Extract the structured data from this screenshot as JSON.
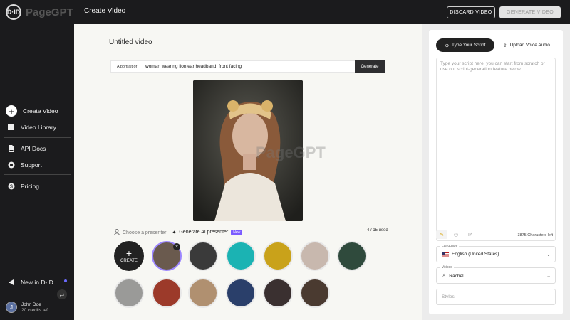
{
  "brand": {
    "logo_mark": "D·ID",
    "watermark": "PageGPT"
  },
  "header": {
    "title": "Create Video",
    "discard_label": "DISCARD VIDEO",
    "generate_label": "GENERATE VIDEO"
  },
  "sidebar": {
    "items": [
      {
        "label": "Create Video",
        "icon": "plus-circle-icon"
      },
      {
        "label": "Video Library",
        "icon": "grid-icon"
      },
      {
        "label": "API Docs",
        "icon": "document-icon"
      },
      {
        "label": "Support",
        "icon": "lifebuoy-icon"
      },
      {
        "label": "Pricing",
        "icon": "dollar-icon"
      }
    ],
    "new_in": "New in D-ID",
    "user": {
      "initial": "J",
      "name": "John Doe",
      "credits": "20 credits left"
    }
  },
  "main": {
    "video_title": "Untitled video",
    "prompt": {
      "prefix": "A portrait of",
      "value": "woman wearing lion ear headband, front facing",
      "button": "Generate"
    },
    "tabs": [
      {
        "label": "Choose a presenter",
        "active": false
      },
      {
        "label": "Generate AI presenter",
        "active": true,
        "badge": "New"
      }
    ],
    "usage": "4 / 15 used",
    "create_label": "CREATE"
  },
  "panel": {
    "tabs": [
      {
        "label": "Type Your Script",
        "active": true
      },
      {
        "label": "Upload Voice Audio",
        "active": false
      }
    ],
    "script_placeholder": "Type your script here, you can start from scratch or use our script-generation feature below.",
    "char_count": "3875 Characters left",
    "language": {
      "label": "Language",
      "value": "English (United States)"
    },
    "voices": {
      "label": "Voices",
      "value": "Rachel"
    },
    "styles": {
      "placeholder": "Styles"
    }
  },
  "colors": {
    "accent": "#7b5cff",
    "sidebar_bg": "#1b1b1d",
    "main_bg": "#f7f7f3"
  }
}
